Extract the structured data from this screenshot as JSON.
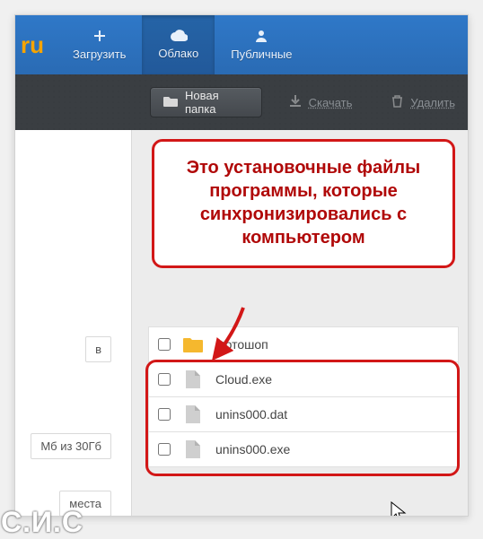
{
  "logo_fragment": "ru",
  "nav": {
    "upload": "Загрузить",
    "cloud": "Облако",
    "public": "Публичные"
  },
  "toolbar": {
    "new_folder": "Новая папка",
    "download": "Скачать",
    "delete": "Удалить"
  },
  "sidebar": {
    "frag1": "в",
    "frag2": "Мб из 30Гб",
    "frag3": "места"
  },
  "callout": "Это установочные файлы программы, которые синхронизировались с компьютером",
  "files": [
    {
      "name": "Фотошоп",
      "type": "folder"
    },
    {
      "name": "Cloud.exe",
      "type": "file"
    },
    {
      "name": "unins000.dat",
      "type": "file"
    },
    {
      "name": "unins000.exe",
      "type": "file"
    }
  ],
  "watermark": "С.И.С"
}
